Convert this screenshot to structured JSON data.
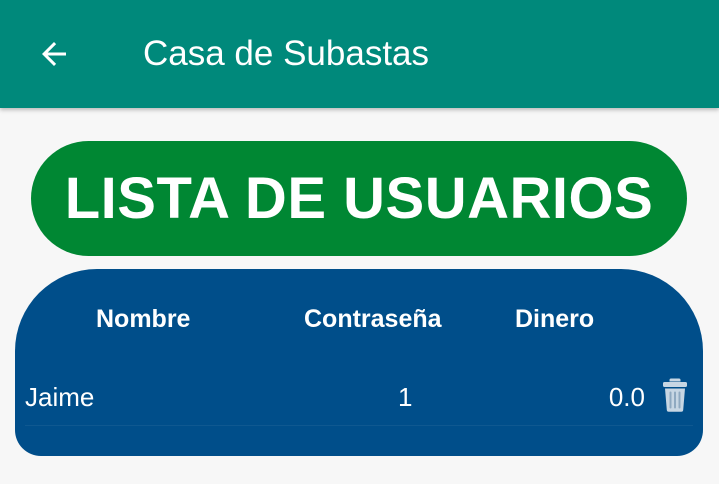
{
  "appbar": {
    "title": "Casa de Subastas",
    "back_icon": "arrow-left-icon",
    "color": "#00897b"
  },
  "header": {
    "title": "LISTA DE USUARIOS",
    "color": "#008733"
  },
  "table": {
    "color": "#004e8a",
    "columns": [
      "Nombre",
      "Contraseña",
      "Dinero"
    ],
    "rows": [
      {
        "nombre": "Jaime",
        "contrasena": "1",
        "dinero": "0.0",
        "action_icon": "trash-icon"
      }
    ]
  }
}
